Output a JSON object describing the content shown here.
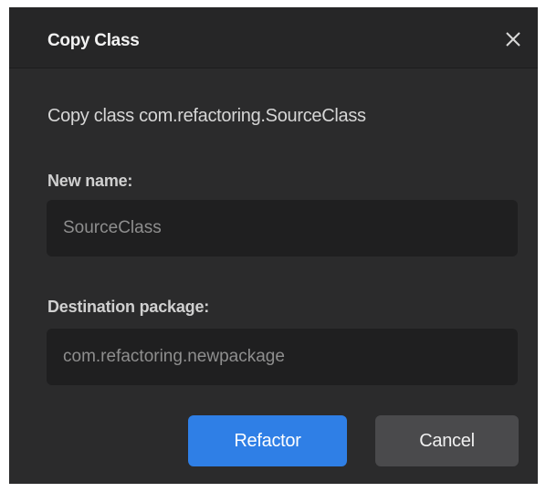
{
  "dialog": {
    "title": "Copy Class",
    "close_icon": "close-icon",
    "description": "Copy class com.refactoring.SourceClass",
    "fields": {
      "new_name": {
        "label": "New name:",
        "value": "SourceClass"
      },
      "destination_package": {
        "label": "Destination package:",
        "placeholder": "com.refactoring.newpackage"
      }
    },
    "buttons": {
      "refactor": "Refactor",
      "cancel": "Cancel"
    }
  },
  "colors": {
    "dialog_bg": "#2b2b2c",
    "titlebar_bg": "#262627",
    "input_bg": "#1f1f20",
    "primary_button": "#2f7fe6",
    "secondary_button": "#4a4a4c"
  }
}
